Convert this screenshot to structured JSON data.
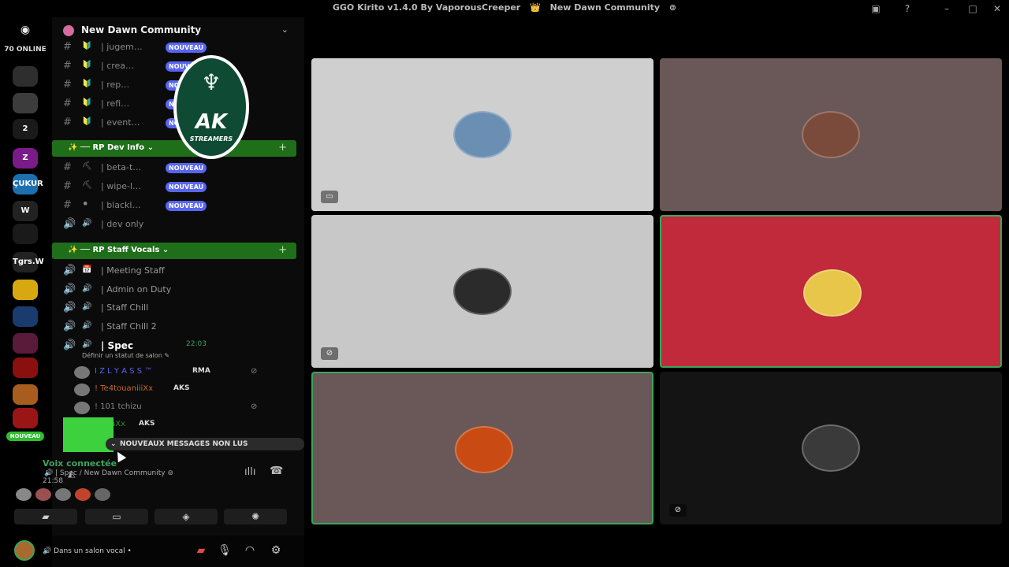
{
  "window": {
    "title_left": "GGO Kirito v1.4.0 By VaporousCreeper",
    "title_right": "New Dawn Community"
  },
  "servers": {
    "online_count": "70 ONLINE",
    "items": [
      {
        "label": "",
        "color": "#2e2e2e"
      },
      {
        "label": "",
        "color": "#3c3c3c"
      },
      {
        "label": "2",
        "color": "#1a1a1a"
      },
      {
        "label": "Z",
        "color": "#7a1b8a"
      },
      {
        "label": "ÇUKUR",
        "color": "#1d6fb0"
      },
      {
        "label": "W",
        "color": "#222"
      },
      {
        "label": "",
        "color": "#1a1a1a"
      },
      {
        "label": "Tgrs.W",
        "color": "#222"
      },
      {
        "label": "",
        "color": "#d8a811"
      },
      {
        "label": "",
        "color": "#1a3b6e"
      },
      {
        "label": "",
        "color": "#5a1a3a"
      },
      {
        "label": "",
        "color": "#8a1010"
      },
      {
        "label": "",
        "color": "#a85d1f"
      },
      {
        "label": "",
        "color": "#9a1515"
      }
    ],
    "new_badge": "NOUVEAU"
  },
  "guild": {
    "name": "New Dawn Community",
    "channels_top": [
      {
        "name": "| jugem…",
        "emoji": "🔰",
        "badge": "NOUVEAU"
      },
      {
        "name": "| crea…",
        "emoji": "🔰",
        "badge": "NOUVEAU"
      },
      {
        "name": "| rep…",
        "emoji": "🔰",
        "badge": "NOUVEAU"
      },
      {
        "name": "| refi…",
        "emoji": "🔰",
        "badge": "NOUVEAU"
      },
      {
        "name": "| event…",
        "emoji": "🔰",
        "badge": "NOUVEAU"
      }
    ],
    "category_dev": "RP Dev Info",
    "channels_dev": [
      {
        "name": "| beta-t…",
        "emoji": "⛏",
        "badge": "NOUVEAU"
      },
      {
        "name": "| wipe-l…",
        "emoji": "⛏",
        "badge": "NOUVEAU"
      },
      {
        "name": "| blackl…",
        "emoji": "⚫",
        "badge": "NOUVEAU"
      },
      {
        "name": "| dev only",
        "emoji": "🔊",
        "badge": ""
      }
    ],
    "category_staff": "RP Staff Vocals",
    "channels_staff": [
      {
        "name": "| Meeting Staff",
        "emoji": "📅"
      },
      {
        "name": "| Admin on Duty",
        "emoji": "🔊"
      },
      {
        "name": "| Staff Chill",
        "emoji": "🔊"
      },
      {
        "name": "| Staff Chill 2",
        "emoji": "🔊"
      }
    ],
    "active_channel": {
      "name": "| Spec",
      "emoji": "🔊",
      "time": "22:03",
      "status_hint": "Définir un statut de salon"
    },
    "members": [
      {
        "name": "I Z L Y A S S ™",
        "tag": "RMA",
        "color": "#5865f2"
      },
      {
        "name": "! Te4touaniiiXx",
        "tag": "AKS",
        "color": "#c46a2a"
      },
      {
        "name": "! 101 tchizu",
        "tag": "",
        "color": "#888888"
      },
      {
        "name": "RéNaXx",
        "tag": "AKS",
        "color": "#2d8a2d"
      }
    ],
    "new_messages": "NOUVEAUX MESSAGES NON LUS",
    "logo": {
      "big": "AK",
      "small": "STREAMERS"
    }
  },
  "voice": {
    "status": "Voix connectée",
    "location": "| Spec / New Dawn Community",
    "elapsed": "21:58",
    "action_buttons": [
      "camera-off",
      "screen-share",
      "activities",
      "soundboard"
    ]
  },
  "user": {
    "status": "Dans un salon vocal"
  },
  "tiles": [
    {
      "bg": "#cfcfcf",
      "pfp": "#6a8fb3",
      "border": "",
      "icon": "screen"
    },
    {
      "bg": "#6a5758",
      "pfp": "#7a4a3a",
      "border": "",
      "icon": ""
    },
    {
      "bg": "#c8c8c8",
      "pfp": "#2b2b2b",
      "border": "",
      "icon": "mute"
    },
    {
      "bg": "#c02a3b",
      "pfp": "#e7c64a",
      "border": "#3ba55d",
      "icon": ""
    },
    {
      "bg": "#6a5758",
      "pfp": "#c94a12",
      "border": "#3ba55d",
      "icon": ""
    },
    {
      "bg": "#141414",
      "pfp": "#3a3a3a",
      "border": "",
      "icon": "mute"
    }
  ]
}
